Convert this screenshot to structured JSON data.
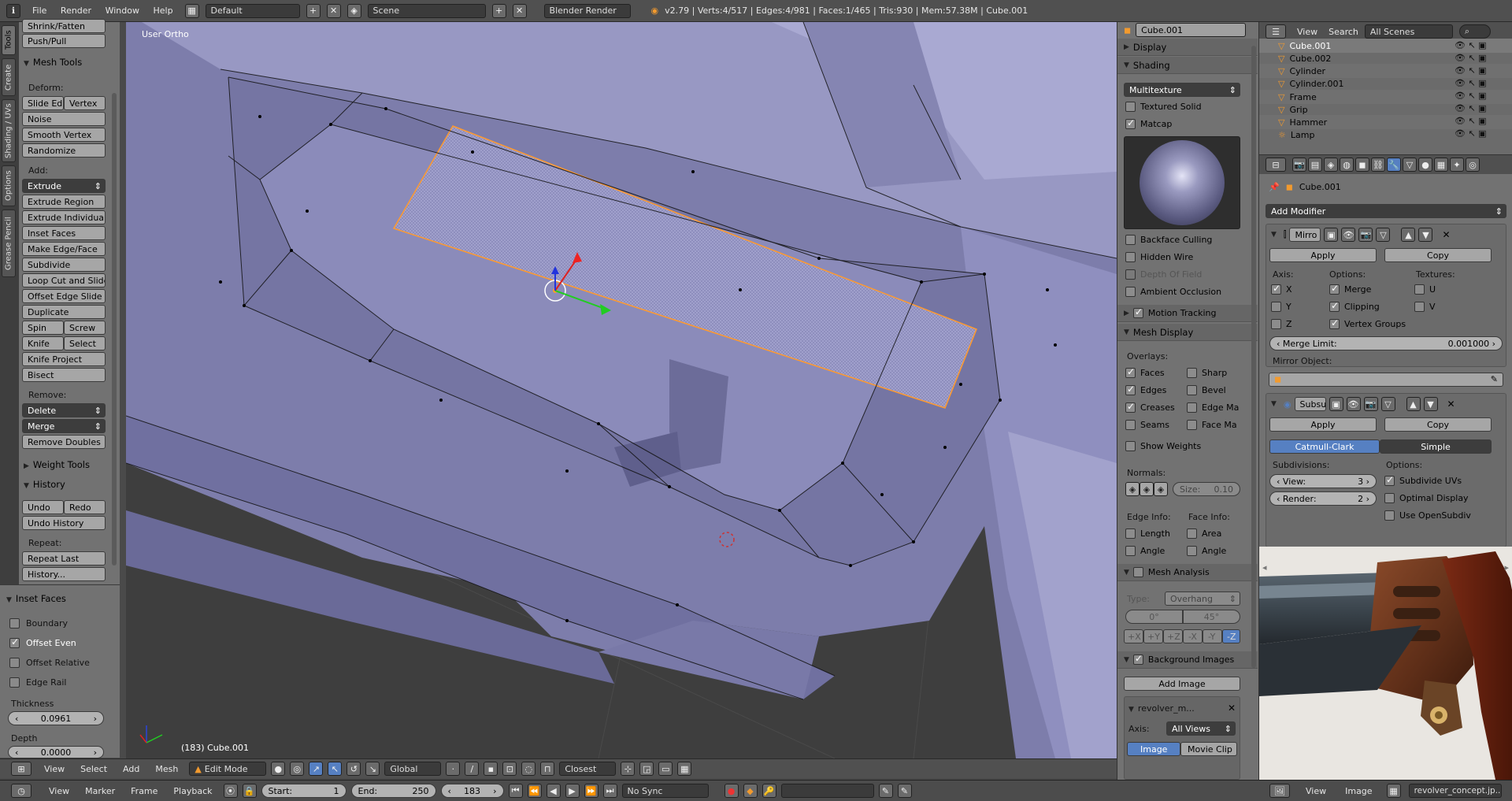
{
  "topbar": {
    "menus": [
      "File",
      "Render",
      "Window",
      "Help"
    ],
    "layout": "Default",
    "scene": "Scene",
    "engine": "Blender Render",
    "stats": "v2.79 | Verts:4/517 | Edges:4/981 | Faces:1/465 | Tris:930 | Mem:57.38M | Cube.001"
  },
  "tabs": [
    "Tools",
    "Create",
    "Shading / UVs",
    "Options",
    "Grease Pencil"
  ],
  "toolshelf": {
    "top_items": [
      "Shrink/Fatten",
      "Push/Pull"
    ],
    "mesh_tools": "Mesh Tools",
    "deform_label": "Deform:",
    "deform": [
      "Slide Ed",
      "Vertex",
      "Noise",
      "Smooth Vertex",
      "Randomize"
    ],
    "add_label": "Add:",
    "add": [
      "Extrude",
      "Extrude Region",
      "Extrude Individual",
      "Inset Faces",
      "Make Edge/Face",
      "Subdivide",
      "Loop Cut and Slide",
      "Offset Edge Slide",
      "Duplicate",
      "Spin",
      "Screw",
      "Knife",
      "Select",
      "Knife Project",
      "Bisect"
    ],
    "remove_label": "Remove:",
    "remove": [
      "Delete",
      "Merge",
      "Remove Doubles"
    ],
    "weight_tools": "Weight Tools",
    "history": "History",
    "history_items": [
      "Undo",
      "Redo",
      "Undo History"
    ],
    "repeat_label": "Repeat:",
    "repeat": [
      "Repeat Last",
      "History..."
    ]
  },
  "operator": {
    "title": "Inset Faces",
    "options": [
      {
        "label": "Boundary",
        "checked": false
      },
      {
        "label": "Offset Even",
        "checked": true
      },
      {
        "label": "Offset Relative",
        "checked": false
      },
      {
        "label": "Edge Rail",
        "checked": false
      }
    ],
    "thickness_label": "Thickness",
    "thickness": "0.0961",
    "depth_label": "Depth",
    "depth": "0.0000"
  },
  "viewport": {
    "view_name": "User Ortho",
    "object_info": "(183) Cube.001"
  },
  "viewport_header": {
    "menus": [
      "View",
      "Select",
      "Add",
      "Mesh"
    ],
    "mode": "Edit Mode",
    "orientation": "Global",
    "snap": "Closest"
  },
  "timeline": {
    "menus": [
      "View",
      "Marker",
      "Frame",
      "Playback"
    ],
    "start_label": "Start:",
    "start": "1",
    "end_label": "End:",
    "end": "250",
    "current": "183",
    "sync": "No Sync"
  },
  "props": {
    "object_name": "Cube.001",
    "display": "Display",
    "shading": "Shading",
    "shading_mode": "Multitexture",
    "textured_solid": "Textured Solid",
    "matcap": "Matcap",
    "backface": "Backface Culling",
    "hidden_wire": "Hidden Wire",
    "dof": "Depth Of Field",
    "ao": "Ambient Occlusion",
    "motion_tracking": "Motion Tracking",
    "mesh_display": "Mesh Display",
    "overlays": "Overlays:",
    "overlay_left": [
      "Faces",
      "Edges",
      "Creases",
      "Seams"
    ],
    "overlay_right": [
      "Sharp",
      "Bevel",
      "Edge Ma",
      "Face Ma"
    ],
    "show_weights": "Show Weights",
    "normals": "Normals:",
    "size": "Size:",
    "size_value": "0.10",
    "edge_info": "Edge Info:",
    "face_info": "Face Info:",
    "length": "Length",
    "area": "Area",
    "angle": "Angle",
    "angle2": "Angle",
    "mesh_analysis": "Mesh Analysis",
    "type_label": "Type:",
    "type_value": "Overhang",
    "range_min": "0°",
    "range_max": "45°",
    "axes": [
      "+X",
      "+Y",
      "+Z",
      "-X",
      "-Y",
      "-Z"
    ],
    "bg_images": "Background Images",
    "add_image": "Add Image",
    "bg_name": "revolver_m...",
    "axis_label": "Axis:",
    "axis_value": "All Views",
    "image_tab": "Image",
    "movie_tab": "Movie Clip"
  },
  "outliner": {
    "menus": [
      "View",
      "Search"
    ],
    "filter": "All Scenes",
    "items": [
      "Cube.001",
      "Cube.002",
      "Cylinder",
      "Cylinder.001",
      "Frame",
      "Grip",
      "Hammer",
      "Lamp"
    ]
  },
  "modifiers": {
    "object_name": "Cube.001",
    "add_modifier": "Add Modifier",
    "mirror": {
      "name": "Mirro",
      "apply": "Apply",
      "copy": "Copy",
      "axis_label": "Axis:",
      "options_label": "Options:",
      "textures_label": "Textures:",
      "axes": [
        {
          "label": "X",
          "checked": true
        },
        {
          "label": "Y",
          "checked": false
        },
        {
          "label": "Z",
          "checked": false
        }
      ],
      "options": [
        {
          "label": "Merge",
          "checked": true
        },
        {
          "label": "Clipping",
          "checked": true
        },
        {
          "label": "Vertex Groups",
          "checked": true
        }
      ],
      "textures": [
        {
          "label": "U",
          "checked": false
        },
        {
          "label": "V",
          "checked": false
        }
      ],
      "merge_limit_label": "Merge Limit:",
      "merge_limit": "0.001000",
      "mirror_object": "Mirror Object:"
    },
    "subsurf": {
      "name": "Subsu",
      "apply": "Apply",
      "copy": "Copy",
      "catmull": "Catmull-Clark",
      "simple": "Simple",
      "subdivisions": "Subdivisions:",
      "options": "Options:",
      "view_label": "View:",
      "view": "3",
      "render_label": "Render:",
      "render": "2",
      "subdivide_uvs": "Subdivide UVs",
      "optimal": "Optimal Display",
      "opensubdiv": "Use OpenSubdiv"
    }
  },
  "imgeditor": {
    "menus": [
      "View",
      "Image"
    ],
    "image_name": "revolver_concept.jp..."
  },
  "colors": {
    "accent_blue": "#5680c2",
    "mesh_face": "#8a8ab5",
    "selection": "#ff9a2e",
    "panel": "#727272"
  }
}
